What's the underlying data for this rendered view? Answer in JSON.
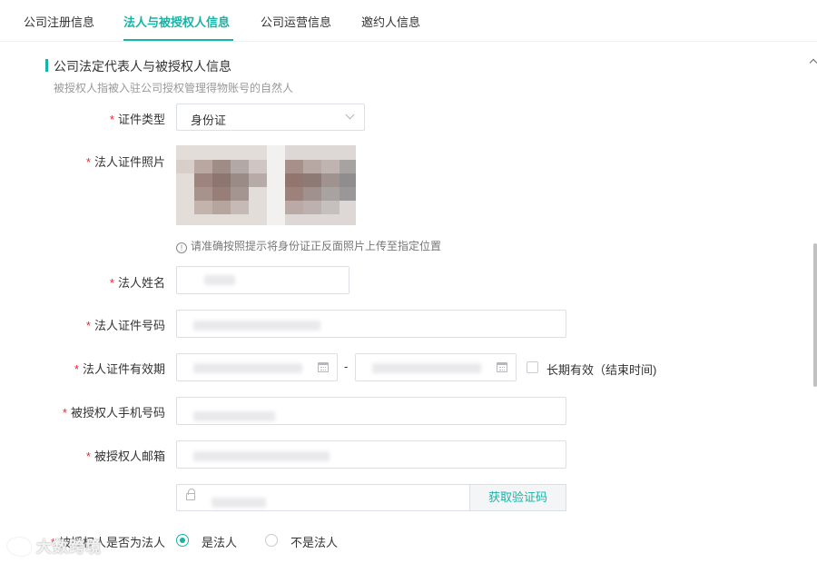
{
  "tabs": [
    {
      "label": "公司注册信息",
      "active": false
    },
    {
      "label": "法人与被授权人信息",
      "active": true
    },
    {
      "label": "公司运营信息",
      "active": false
    },
    {
      "label": "邀约人信息",
      "active": false
    }
  ],
  "section": {
    "title": "公司法定代表人与被授权人信息",
    "subtitle": "被授权人指被入驻公司授权管理得物账号的自然人"
  },
  "form": {
    "id_type": {
      "label": "证件类型",
      "value": "身份证"
    },
    "id_photo": {
      "label": "法人证件照片",
      "hint": "请准确按照提示将身份证正反面照片上传至指定位置"
    },
    "legal_name": {
      "label": "法人姓名"
    },
    "legal_id_number": {
      "label": "法人证件号码"
    },
    "legal_id_validity": {
      "label": "法人证件有效期",
      "separator": "-",
      "long_term_label": "长期有效（结束时间)",
      "long_term_checked": false
    },
    "auth_phone": {
      "label": "被授权人手机号码"
    },
    "auth_email": {
      "label": "被授权人邮箱"
    },
    "verify_code": {
      "button_label": "获取验证码"
    },
    "is_legal": {
      "label": "被授权人是否为法人",
      "options": [
        "是法人",
        "不是法人"
      ],
      "selected": "是法人"
    }
  },
  "required_mark": "*",
  "hint_icon_glyph": "!",
  "watermark": "大数跨境",
  "colors": {
    "accent": "#19b3a6",
    "required": "#f5222d",
    "border": "#dcdfe6"
  }
}
